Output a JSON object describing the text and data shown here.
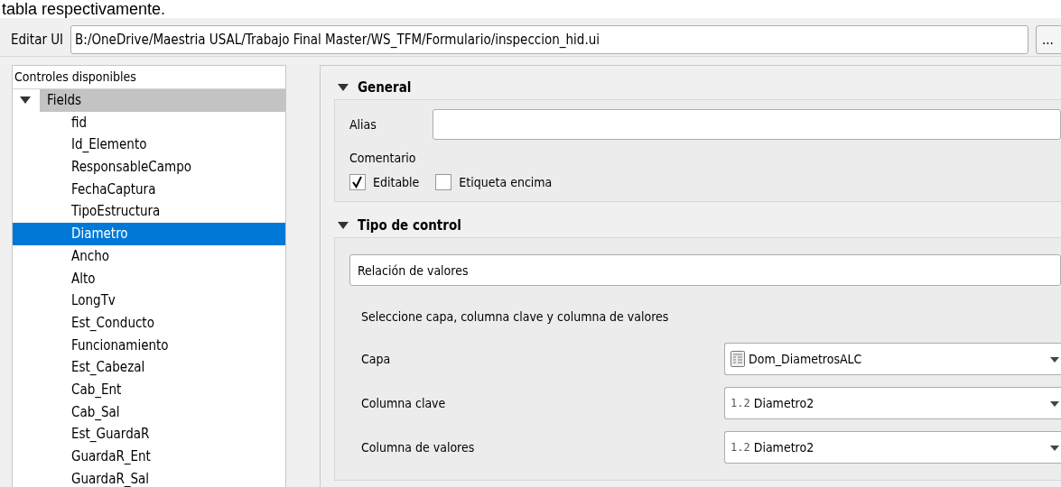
{
  "caption": "tabla respectivamente.",
  "ui_file": {
    "label": "Editar UI",
    "value": "B:/OneDrive/Maestria USAL/Trabajo Final Master/WS_TFM/Formulario/inspeccion_hid.ui",
    "button": "..."
  },
  "controls": {
    "header": "Controles disponibles",
    "tree": [
      {
        "label": "Fields",
        "expanded": true,
        "highlighted": true,
        "children": [
          {
            "label": "fid",
            "selected": false
          },
          {
            "label": "Id_Elemento",
            "selected": false
          },
          {
            "label": "ResponsableCampo",
            "selected": false
          },
          {
            "label": "FechaCaptura",
            "selected": false
          },
          {
            "label": "TipoEstructura",
            "selected": false
          },
          {
            "label": "Diametro",
            "selected": true
          },
          {
            "label": "Ancho",
            "selected": false
          },
          {
            "label": "Alto",
            "selected": false
          },
          {
            "label": "LongTv",
            "selected": false
          },
          {
            "label": "Est_Conducto",
            "selected": false
          },
          {
            "label": "Funcionamiento",
            "selected": false
          },
          {
            "label": "Est_Cabezal",
            "selected": false
          },
          {
            "label": "Cab_Ent",
            "selected": false
          },
          {
            "label": "Cab_Sal",
            "selected": false
          },
          {
            "label": "Est_GuardaR",
            "selected": false
          },
          {
            "label": "GuardaR_Ent",
            "selected": false
          },
          {
            "label": "GuardaR_Sal",
            "selected": false
          }
        ]
      }
    ]
  },
  "general": {
    "title": "General",
    "expanded": true,
    "alias_label": "Alias",
    "comment_label": "Comentario",
    "checkboxes": [
      {
        "label": "Editable",
        "checked": true
      },
      {
        "label": "Etiqueta encima",
        "checked": false
      }
    ]
  },
  "widget_type": {
    "title": "Tipo de control",
    "expanded": true,
    "type": "Relación de valores",
    "instructions": "Seleccione capa, columna clave y columna de valores",
    "settings": [
      {
        "label": "Capa",
        "value": "Dom_DiametrosALC",
        "kind": "layer"
      },
      {
        "label": "Columna clave",
        "value": "Diametro2",
        "kind": "decimal",
        "badge": "1.2"
      },
      {
        "label": "Columna de valores",
        "value": "Diametro2",
        "kind": "decimal",
        "badge": "1.2"
      }
    ]
  }
}
